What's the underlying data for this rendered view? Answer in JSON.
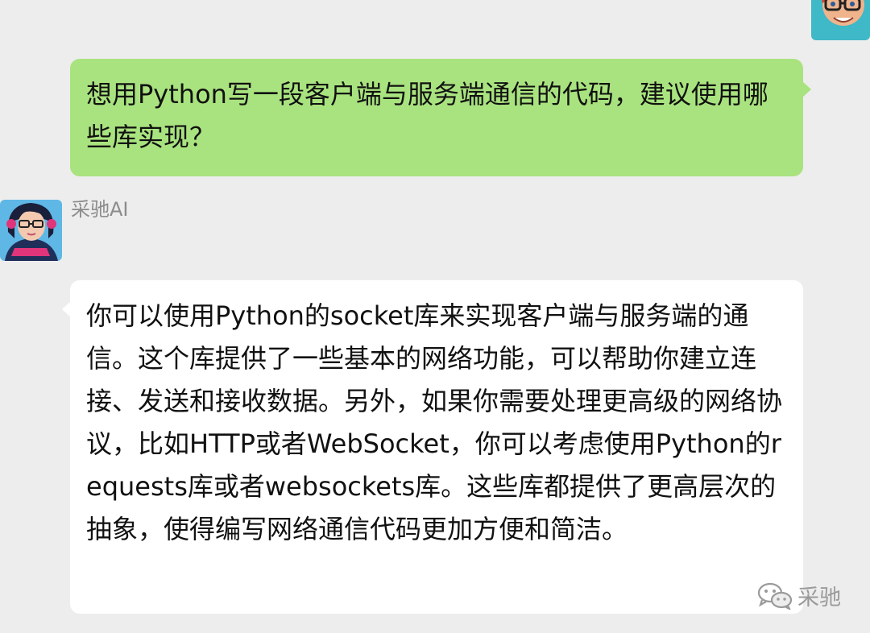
{
  "chat": {
    "user_message": "想用Python写一段客户端与服务端通信的代码，建议使用哪些库实现？",
    "ai_sender_name": "采驰AI",
    "ai_message": "你可以使用Python的socket库来实现客户端与服务端的通信。这个库提供了一些基本的网络功能，可以帮助你建立连接、发送和接收数据。另外，如果你需要处理更高级的网络协议，比如HTTP或者WebSocket，你可以考虑使用Python的requests库或者websockets库。这些库都提供了更高层次的抽象，使得编写网络通信代码更加方便和简洁。"
  },
  "watermark": {
    "icon": "wechat-icon",
    "text": "采驰"
  },
  "colors": {
    "background": "#ededed",
    "user_bubble": "#a9e37f",
    "ai_bubble": "#ffffff",
    "name_text": "#8c8c8c"
  }
}
